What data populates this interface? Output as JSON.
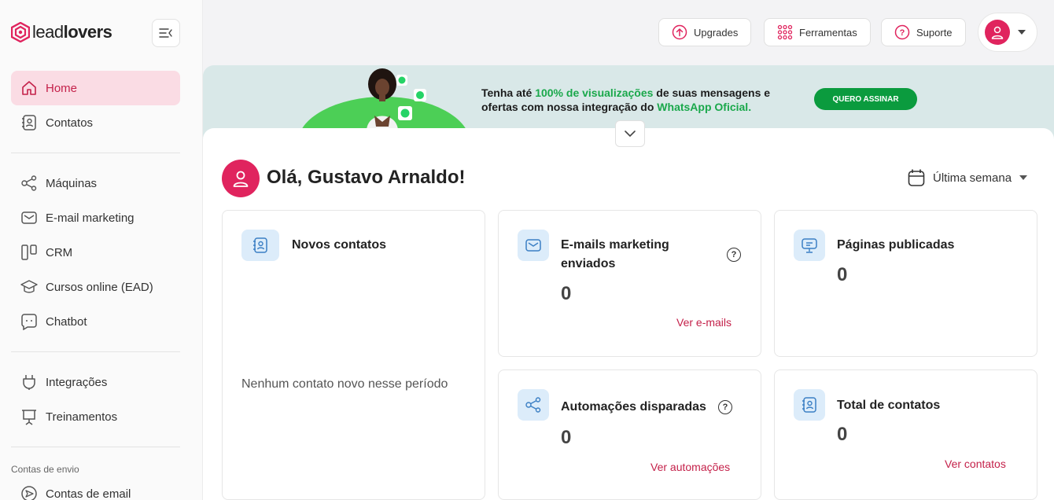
{
  "brand": {
    "logo_light": "lead",
    "logo_bold": "lovers",
    "accent": "#e0245e"
  },
  "sidebar": {
    "items": [
      {
        "label": "Home",
        "icon": "home-icon"
      },
      {
        "label": "Contatos",
        "icon": "contacts-icon"
      },
      {
        "label": "Máquinas",
        "icon": "share-nodes-icon"
      },
      {
        "label": "E-mail marketing",
        "icon": "mail-icon"
      },
      {
        "label": "CRM",
        "icon": "columns-icon"
      },
      {
        "label": "Cursos online (EAD)",
        "icon": "graduation-cap-icon"
      },
      {
        "label": "Chatbot",
        "icon": "chat-icon"
      },
      {
        "label": "Integrações",
        "icon": "plug-icon"
      },
      {
        "label": "Treinamentos",
        "icon": "presentation-icon"
      },
      {
        "label": "Contas de email",
        "icon": "send-icon"
      }
    ],
    "section_label": "Contas de envio"
  },
  "header": {
    "upgrades": "Upgrades",
    "ferramentas": "Ferramentas",
    "suporte": "Suporte"
  },
  "banner": {
    "text_1": "Tenha até ",
    "text_2": "100% de visualizações",
    "text_3": " de suas mensagens e",
    "text_4": "ofertas com nossa integração do ",
    "text_5": "WhatsApp Oficial.",
    "cta": "QUERO ASSINAR"
  },
  "main": {
    "greeting": "Olá, Gustavo Arnaldo!",
    "period": "Última semana"
  },
  "cards": {
    "novos_contatos": {
      "title": "Novos contatos",
      "empty": "Nenhum contato novo nesse período"
    },
    "emails": {
      "title_1": "E-mails marketing",
      "title_2": "enviados",
      "value": "0",
      "link": "Ver e-mails"
    },
    "paginas": {
      "title": "Páginas publicadas",
      "value": "0"
    },
    "automacoes": {
      "title": "Automações disparadas",
      "value": "0",
      "link": "Ver automações"
    },
    "total": {
      "title": "Total de contatos",
      "value": "0",
      "link": "Ver contatos"
    }
  }
}
